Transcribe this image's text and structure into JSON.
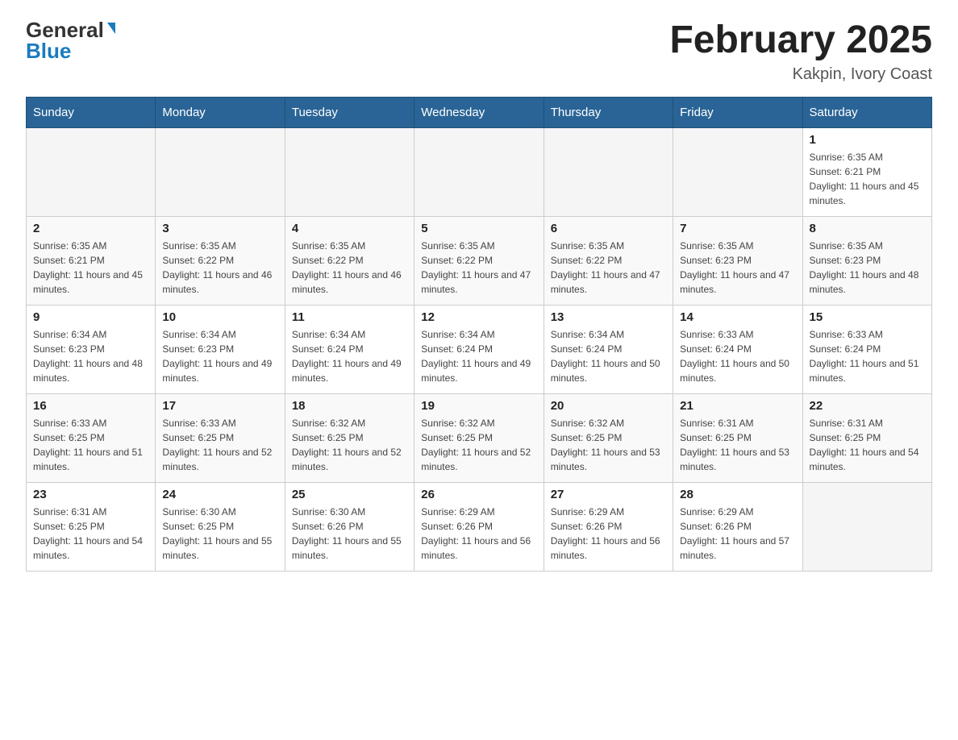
{
  "header": {
    "logo_general": "General",
    "logo_blue": "Blue",
    "month_title": "February 2025",
    "location": "Kakpin, Ivory Coast"
  },
  "days_of_week": [
    "Sunday",
    "Monday",
    "Tuesday",
    "Wednesday",
    "Thursday",
    "Friday",
    "Saturday"
  ],
  "weeks": [
    [
      {
        "day": "",
        "info": ""
      },
      {
        "day": "",
        "info": ""
      },
      {
        "day": "",
        "info": ""
      },
      {
        "day": "",
        "info": ""
      },
      {
        "day": "",
        "info": ""
      },
      {
        "day": "",
        "info": ""
      },
      {
        "day": "1",
        "info": "Sunrise: 6:35 AM\nSunset: 6:21 PM\nDaylight: 11 hours and 45 minutes."
      }
    ],
    [
      {
        "day": "2",
        "info": "Sunrise: 6:35 AM\nSunset: 6:21 PM\nDaylight: 11 hours and 45 minutes."
      },
      {
        "day": "3",
        "info": "Sunrise: 6:35 AM\nSunset: 6:22 PM\nDaylight: 11 hours and 46 minutes."
      },
      {
        "day": "4",
        "info": "Sunrise: 6:35 AM\nSunset: 6:22 PM\nDaylight: 11 hours and 46 minutes."
      },
      {
        "day": "5",
        "info": "Sunrise: 6:35 AM\nSunset: 6:22 PM\nDaylight: 11 hours and 47 minutes."
      },
      {
        "day": "6",
        "info": "Sunrise: 6:35 AM\nSunset: 6:22 PM\nDaylight: 11 hours and 47 minutes."
      },
      {
        "day": "7",
        "info": "Sunrise: 6:35 AM\nSunset: 6:23 PM\nDaylight: 11 hours and 47 minutes."
      },
      {
        "day": "8",
        "info": "Sunrise: 6:35 AM\nSunset: 6:23 PM\nDaylight: 11 hours and 48 minutes."
      }
    ],
    [
      {
        "day": "9",
        "info": "Sunrise: 6:34 AM\nSunset: 6:23 PM\nDaylight: 11 hours and 48 minutes."
      },
      {
        "day": "10",
        "info": "Sunrise: 6:34 AM\nSunset: 6:23 PM\nDaylight: 11 hours and 49 minutes."
      },
      {
        "day": "11",
        "info": "Sunrise: 6:34 AM\nSunset: 6:24 PM\nDaylight: 11 hours and 49 minutes."
      },
      {
        "day": "12",
        "info": "Sunrise: 6:34 AM\nSunset: 6:24 PM\nDaylight: 11 hours and 49 minutes."
      },
      {
        "day": "13",
        "info": "Sunrise: 6:34 AM\nSunset: 6:24 PM\nDaylight: 11 hours and 50 minutes."
      },
      {
        "day": "14",
        "info": "Sunrise: 6:33 AM\nSunset: 6:24 PM\nDaylight: 11 hours and 50 minutes."
      },
      {
        "day": "15",
        "info": "Sunrise: 6:33 AM\nSunset: 6:24 PM\nDaylight: 11 hours and 51 minutes."
      }
    ],
    [
      {
        "day": "16",
        "info": "Sunrise: 6:33 AM\nSunset: 6:25 PM\nDaylight: 11 hours and 51 minutes."
      },
      {
        "day": "17",
        "info": "Sunrise: 6:33 AM\nSunset: 6:25 PM\nDaylight: 11 hours and 52 minutes."
      },
      {
        "day": "18",
        "info": "Sunrise: 6:32 AM\nSunset: 6:25 PM\nDaylight: 11 hours and 52 minutes."
      },
      {
        "day": "19",
        "info": "Sunrise: 6:32 AM\nSunset: 6:25 PM\nDaylight: 11 hours and 52 minutes."
      },
      {
        "day": "20",
        "info": "Sunrise: 6:32 AM\nSunset: 6:25 PM\nDaylight: 11 hours and 53 minutes."
      },
      {
        "day": "21",
        "info": "Sunrise: 6:31 AM\nSunset: 6:25 PM\nDaylight: 11 hours and 53 minutes."
      },
      {
        "day": "22",
        "info": "Sunrise: 6:31 AM\nSunset: 6:25 PM\nDaylight: 11 hours and 54 minutes."
      }
    ],
    [
      {
        "day": "23",
        "info": "Sunrise: 6:31 AM\nSunset: 6:25 PM\nDaylight: 11 hours and 54 minutes."
      },
      {
        "day": "24",
        "info": "Sunrise: 6:30 AM\nSunset: 6:25 PM\nDaylight: 11 hours and 55 minutes."
      },
      {
        "day": "25",
        "info": "Sunrise: 6:30 AM\nSunset: 6:26 PM\nDaylight: 11 hours and 55 minutes."
      },
      {
        "day": "26",
        "info": "Sunrise: 6:29 AM\nSunset: 6:26 PM\nDaylight: 11 hours and 56 minutes."
      },
      {
        "day": "27",
        "info": "Sunrise: 6:29 AM\nSunset: 6:26 PM\nDaylight: 11 hours and 56 minutes."
      },
      {
        "day": "28",
        "info": "Sunrise: 6:29 AM\nSunset: 6:26 PM\nDaylight: 11 hours and 57 minutes."
      },
      {
        "day": "",
        "info": ""
      }
    ]
  ]
}
